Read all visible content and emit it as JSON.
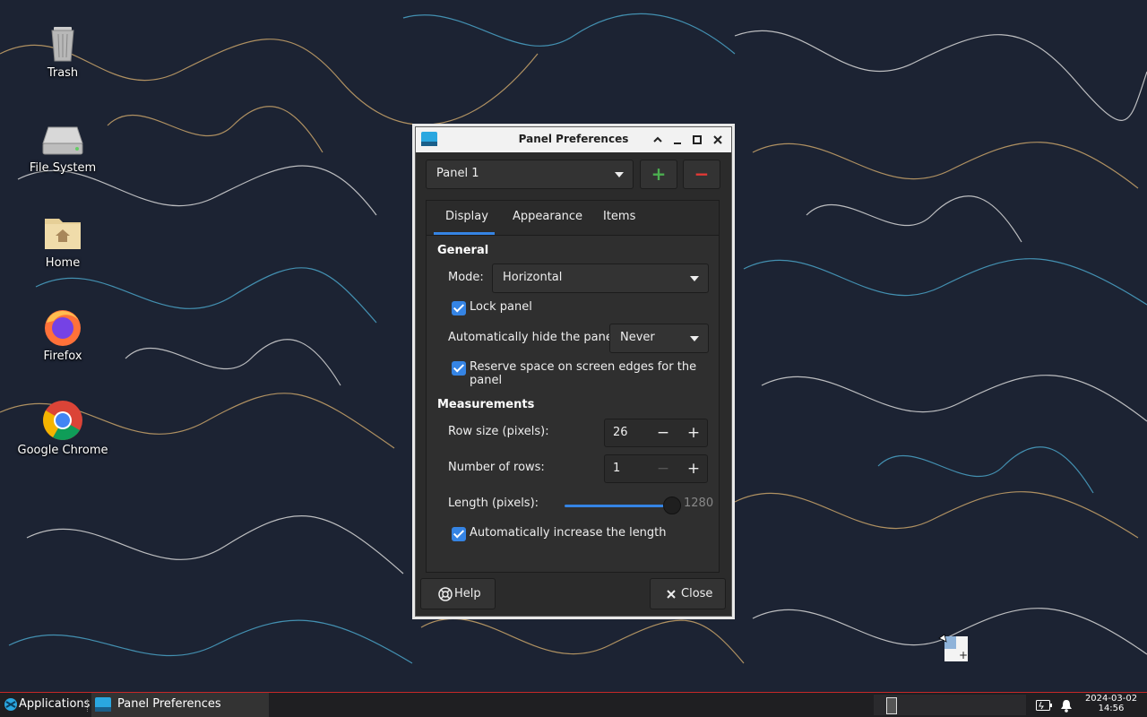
{
  "desktop": {
    "icons": [
      {
        "label": "Trash",
        "icon": "trash-icon"
      },
      {
        "label": "File System",
        "icon": "drive-icon"
      },
      {
        "label": "Home",
        "icon": "home-folder-icon"
      },
      {
        "label": "Firefox",
        "icon": "firefox-icon"
      },
      {
        "label": "Google Chrome",
        "icon": "chrome-icon"
      }
    ]
  },
  "window": {
    "title": "Panel Preferences",
    "panel_select": "Panel 1",
    "add_label": "+",
    "remove_label": "−",
    "tabs": [
      "Display",
      "Appearance",
      "Items"
    ],
    "active_tab": "Display",
    "general": {
      "heading": "General",
      "mode_label": "Mode:",
      "mode_value": "Horizontal",
      "lock_panel": "Lock panel",
      "autohide_label": "Automatically hide the panel:",
      "autohide_value": "Never",
      "reserve_space": "Reserve space on screen edges for the panel"
    },
    "measurements": {
      "heading": "Measurements",
      "row_size_label": "Row size (pixels):",
      "row_size_value": "26",
      "rows_label": "Number of rows:",
      "rows_value": "1",
      "length_label": "Length (pixels):",
      "length_value": "1280",
      "auto_increase": "Automatically increase the length"
    },
    "help_label": "Help",
    "close_label": "Close"
  },
  "taskbar": {
    "applications": "Applications",
    "task": "Panel Preferences",
    "date": "2024-03-02",
    "time": "14:56"
  },
  "colors": {
    "accent": "#3584e4",
    "add": "#4caf50",
    "remove": "#e53935",
    "taskbar_border": "#c62828"
  }
}
